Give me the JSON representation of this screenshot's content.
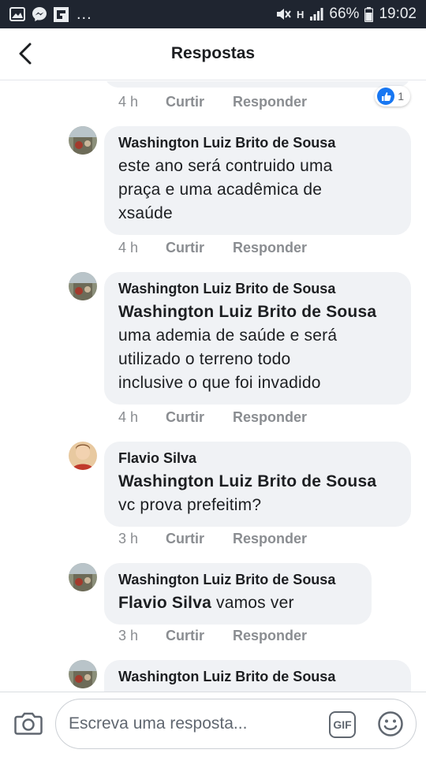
{
  "status_bar": {
    "battery": "66%",
    "time": "19:02",
    "network": "H",
    "more": "..."
  },
  "header": {
    "title": "Respostas"
  },
  "actions": {
    "like": "Curtir",
    "reply": "Responder"
  },
  "top_meta": {
    "time": "4 h",
    "reaction_count": "1"
  },
  "comments": [
    {
      "author": "Washington Luiz Brito de Sousa",
      "lines": [
        "este ano será contruido uma",
        "praça e uma acadêmica de",
        "xsaúde"
      ],
      "time": "4 h"
    },
    {
      "author": "Washington Luiz Brito de Sousa",
      "mention": "Washington Luiz Brito de Sousa",
      "lines": [
        "uma ademia de saúde e será",
        "utilizado o terreno todo",
        "inclusive o que foi invadido"
      ],
      "time": "4 h"
    },
    {
      "author": "Flavio Silva",
      "mention": "Washington Luiz Brito de Sousa",
      "lines": [
        "vc prova prefeitim?"
      ],
      "time": "3 h"
    },
    {
      "author": "Washington Luiz Brito de Sousa",
      "mention": "Flavio Silva",
      "text": "vamos  ver",
      "time": "3 h"
    },
    {
      "author": "Washington Luiz Brito de Sousa"
    }
  ],
  "composer": {
    "placeholder": "Escreva uma resposta...",
    "gif_label": "GIF"
  },
  "colors": {
    "status_bar_bg": "#1f2530",
    "bubble_bg": "#f0f2f5",
    "meta_text": "#8a8d91",
    "like_blue": "#1877f2"
  }
}
